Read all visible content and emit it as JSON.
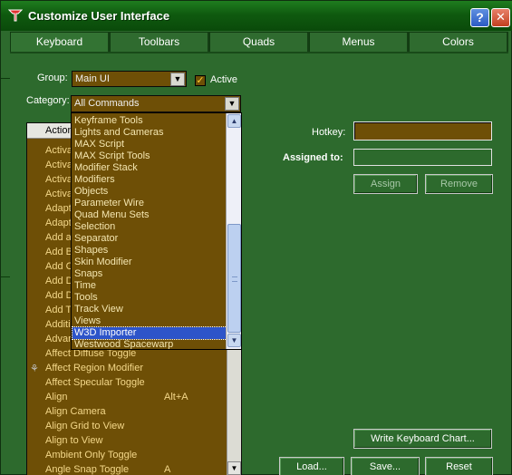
{
  "window": {
    "title": "Customize User Interface",
    "help_label": "?",
    "close_label": "✕"
  },
  "tabs": [
    {
      "label": "Keyboard",
      "active": true
    },
    {
      "label": "Toolbars",
      "active": false
    },
    {
      "label": "Quads",
      "active": false
    },
    {
      "label": "Menus",
      "active": false
    },
    {
      "label": "Colors",
      "active": false
    }
  ],
  "group": {
    "label": "Group:",
    "value": "Main UI"
  },
  "active": {
    "label": "Active",
    "checked": true,
    "check_glyph": "✓"
  },
  "category": {
    "label": "Category:",
    "value": "All Commands"
  },
  "dropdown_arrow": "▼",
  "action_list": {
    "header": "Action",
    "rows": [
      {
        "name": "Activa",
        "hotkey": ""
      },
      {
        "name": "Activa",
        "hotkey": ""
      },
      {
        "name": "Activa",
        "hotkey": ""
      },
      {
        "name": "Activa",
        "hotkey": ""
      },
      {
        "name": "Adapt",
        "hotkey": ""
      },
      {
        "name": "Adapt",
        "hotkey": ""
      },
      {
        "name": "Add a",
        "hotkey": ""
      },
      {
        "name": "Add B",
        "hotkey": ""
      },
      {
        "name": "Add C",
        "hotkey": ""
      },
      {
        "name": "Add D",
        "hotkey": ""
      },
      {
        "name": "Add D",
        "hotkey": ""
      },
      {
        "name": "Add T",
        "hotkey": ""
      },
      {
        "name": "Additi",
        "hotkey": ""
      },
      {
        "name": "Advar",
        "hotkey": ""
      },
      {
        "name": "Affect Diffuse Toggle",
        "hotkey": ""
      },
      {
        "name": "Affect Region Modifier",
        "hotkey": "",
        "icon": "⚘"
      },
      {
        "name": "Affect Specular Toggle",
        "hotkey": ""
      },
      {
        "name": "Align",
        "hotkey": "Alt+A"
      },
      {
        "name": "Align Camera",
        "hotkey": ""
      },
      {
        "name": "Align Grid to View",
        "hotkey": ""
      },
      {
        "name": "Align to View",
        "hotkey": ""
      },
      {
        "name": "Ambient Only Toggle",
        "hotkey": ""
      },
      {
        "name": "Angle Snap Toggle",
        "hotkey": "A"
      }
    ]
  },
  "category_options": [
    "Keyframe Tools",
    "Lights and Cameras",
    "MAX Script",
    "MAX Script Tools",
    "Modifier Stack",
    "Modifiers",
    "Objects",
    "Parameter Wire",
    "Quad Menu Sets",
    "Selection",
    "Separator",
    "Shapes",
    "Skin Modifier",
    "Snaps",
    "Time",
    "Tools",
    "Track View",
    "Views",
    "W3D Importer",
    "Westwood Spacewarp"
  ],
  "category_selected_index": 18,
  "hotkey": {
    "label": "Hotkey:",
    "value": ""
  },
  "assigned_to": {
    "label": "Assigned to:",
    "value": ""
  },
  "buttons": {
    "assign": "Assign",
    "remove": "Remove",
    "write_chart": "Write Keyboard Chart...",
    "load": "Load...",
    "save": "Save...",
    "reset": "Reset"
  },
  "scroll_arrows": {
    "up": "▲",
    "down": "▼"
  }
}
